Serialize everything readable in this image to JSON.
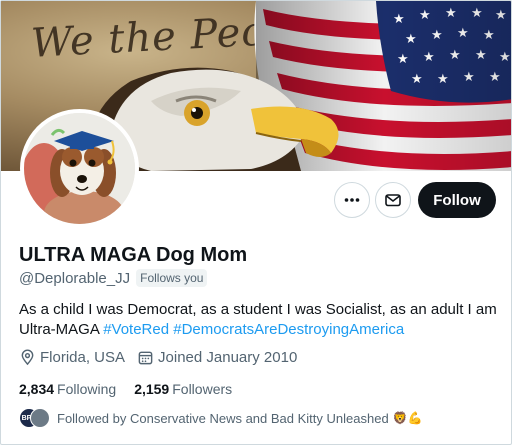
{
  "banner": {
    "script_title": "We the People"
  },
  "profile": {
    "display_name": "ULTRA MAGA Dog Mom",
    "handle": "@Deplorable_JJ",
    "follows_you": "Follows you",
    "bio_text": "As a child I was Democrat, as a student I was Socialist, as an adult I am Ultra-MAGA ",
    "bio_hashtag_1": "#VoteRed",
    "bio_hashtag_2": "#DemocratsAreDestroyingAmerica",
    "location": "Florida, USA",
    "joined": "Joined January 2010"
  },
  "actions": {
    "follow_label": "Follow",
    "more_icon": "ellipsis-icon",
    "message_icon": "envelope-icon"
  },
  "stats": {
    "following_count": "2,834",
    "following_label": "Following",
    "followers_count": "2,159",
    "followers_label": "Followers"
  },
  "followed_by": {
    "text": "Followed by Conservative News and Bad Kitty Unleashed",
    "avatar_1_text": "BPR",
    "emoji": "🦁💪"
  },
  "colors": {
    "accent": "#1d9bf0",
    "text_primary": "#0f1419",
    "text_secondary": "#536471",
    "follow_button": "#0f1419"
  }
}
